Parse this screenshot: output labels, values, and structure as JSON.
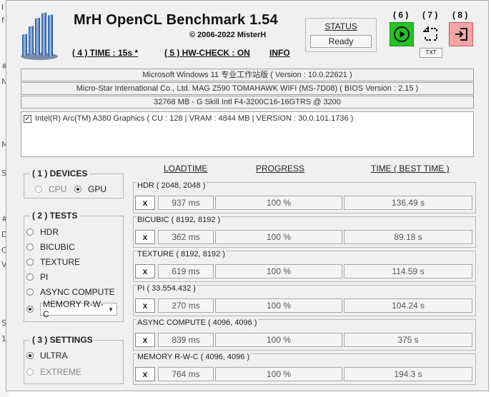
{
  "background_fragments": [
    "I",
    "f",
    "#",
    "N",
    "M",
    "S",
    "#",
    "D",
    "C",
    "V",
    "S",
    "1"
  ],
  "app": {
    "title": "MrH OpenCL Benchmark 1.54",
    "copyright": "©  2006-2022 MisterH",
    "time_link": "( 4 ) TIME : 15s *",
    "hwcheck_link": "( 5 ) HW-CHECK : ON",
    "info_link": "INFO"
  },
  "status": {
    "label": "STATUS",
    "value": "Ready"
  },
  "toolbar": {
    "run_num": "( 6 )",
    "crop_num": "( 7 )",
    "exit_num": "( 8 )",
    "txt_label": "TXT",
    "run_color": "#22c322",
    "exit_color": "#f4a6a6"
  },
  "system": {
    "os": "Microsoft Windows 11 专业工作站版 ( Version : 10.0.22621 )",
    "board": "Micro-Star International Co., Ltd. MAG Z590 TOMAHAWK WIFI (MS-7D08) ( BIOS Version : 2.15 )",
    "memory": "32768 MB - G Skill Intl F4-3200C16-16GTRS    @ 3200"
  },
  "gpu": {
    "checked": true,
    "text": "Intel(R) Arc(TM) A380  Graphics ( CU : 128 | VRAM : 4844 MB | VERSION : 30.0.101.1736 )"
  },
  "devices": {
    "legend": "( 1 ) DEVICES",
    "cpu_label": "CPU",
    "gpu_label": "GPU",
    "selected": "GPU"
  },
  "tests_group": {
    "legend": "( 2 ) TESTS",
    "items": [
      "HDR",
      "BICUBIC",
      "TEXTURE",
      "PI",
      "ASYNC COMPUTE"
    ],
    "memory_select": "MEMORY R-W-C",
    "selected": "MEMORY R-W-C"
  },
  "settings": {
    "legend": "( 3 ) SETTINGS",
    "ultra_label": "ULTRA",
    "extreme_label": "EXTREME",
    "selected": "ULTRA"
  },
  "columns": {
    "loadtime": "LOADTIME",
    "progress": "PROGRESS",
    "time": "TIME ( BEST TIME )"
  },
  "results": [
    {
      "name": "HDR ( 2048, 2048 )",
      "button": "x",
      "loadtime": "937 ms",
      "progress": "100 %",
      "time": "136.49 s"
    },
    {
      "name": "BICUBIC ( 8192, 8192 )",
      "button": "x",
      "loadtime": "362 ms",
      "progress": "100 %",
      "time": "89.18 s"
    },
    {
      "name": "TEXTURE ( 8192, 8192 )",
      "button": "x",
      "loadtime": "619 ms",
      "progress": "100 %",
      "time": "114.59 s"
    },
    {
      "name": "PI ( 33.554.432 )",
      "button": "x",
      "loadtime": "270 ms",
      "progress": "100 %",
      "time": "104.24 s"
    },
    {
      "name": "ASYNC COMPUTE ( 4096, 4096 )",
      "button": "x",
      "loadtime": "839 ms",
      "progress": "100 %",
      "time": "375 s"
    },
    {
      "name": "MEMORY R-W-C ( 4096, 4096 )",
      "button": "x",
      "loadtime": "764 ms",
      "progress": "100 %",
      "time": "194.3 s"
    }
  ]
}
